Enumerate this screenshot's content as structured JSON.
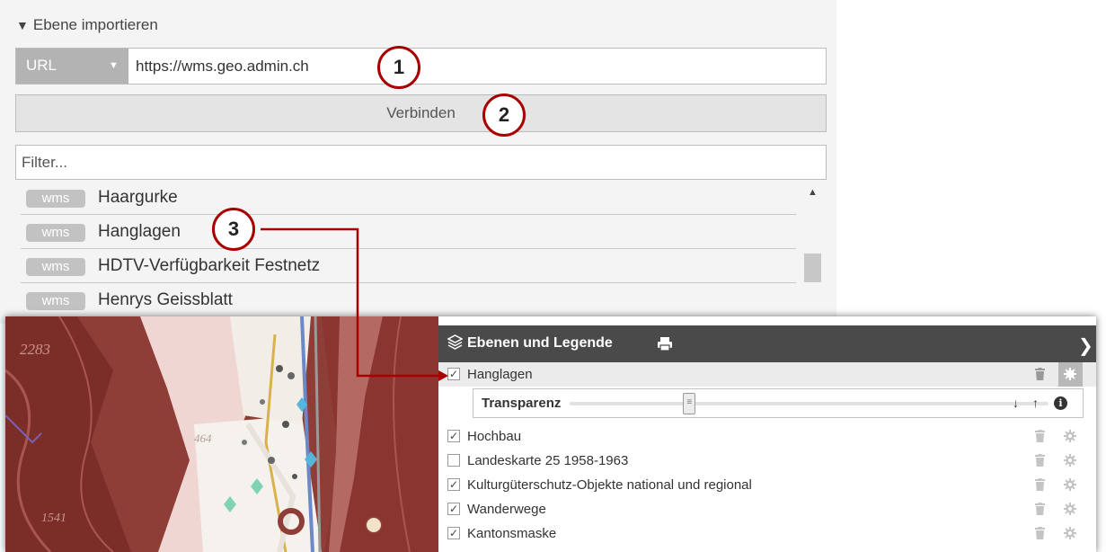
{
  "import": {
    "title": "Ebene importieren",
    "source_select": "URL",
    "url_value": "https://wms.geo.admin.ch",
    "connect_label": "Verbinden",
    "filter_placeholder": "Filter...",
    "results": [
      {
        "badge": "wms",
        "name": "Haargurke"
      },
      {
        "badge": "wms",
        "name": "Hanglagen"
      },
      {
        "badge": "wms",
        "name": "HDTV-Verfügbarkeit Festnetz"
      },
      {
        "badge": "wms",
        "name": "Henrys Geissblatt"
      }
    ]
  },
  "legend": {
    "title": "Ebenen und Legende",
    "transparency_label": "Transparenz",
    "transparency_value": 0.25,
    "layers": [
      {
        "label": "Hanglagen",
        "checked": true,
        "selected": true
      },
      {
        "label": "Hochbau",
        "checked": true,
        "selected": false
      },
      {
        "label": "Landeskarte 25 1958-1963",
        "checked": false,
        "selected": false
      },
      {
        "label": "Kulturgüterschutz-Objekte national und regional",
        "checked": true,
        "selected": false
      },
      {
        "label": "Wanderwege",
        "checked": true,
        "selected": false
      },
      {
        "label": "Kantonsmaske",
        "checked": true,
        "selected": false
      }
    ]
  },
  "callouts": [
    "1",
    "2",
    "3"
  ],
  "map": {
    "labels": [
      "2283",
      "464",
      "1541"
    ]
  },
  "colors": {
    "callout_border": "#a80000",
    "legend_header": "#4a4a4a",
    "badge": "#c2c2c2",
    "map_relief": "#8e3b34"
  },
  "icons": {
    "layers": "layers-icon",
    "print": "print-icon",
    "collapse": "chevron-right-icon",
    "delete": "trash-icon",
    "settings": "gear-icon",
    "move_down": "arrow-down-icon",
    "move_up": "arrow-up-icon",
    "info": "info-icon"
  }
}
